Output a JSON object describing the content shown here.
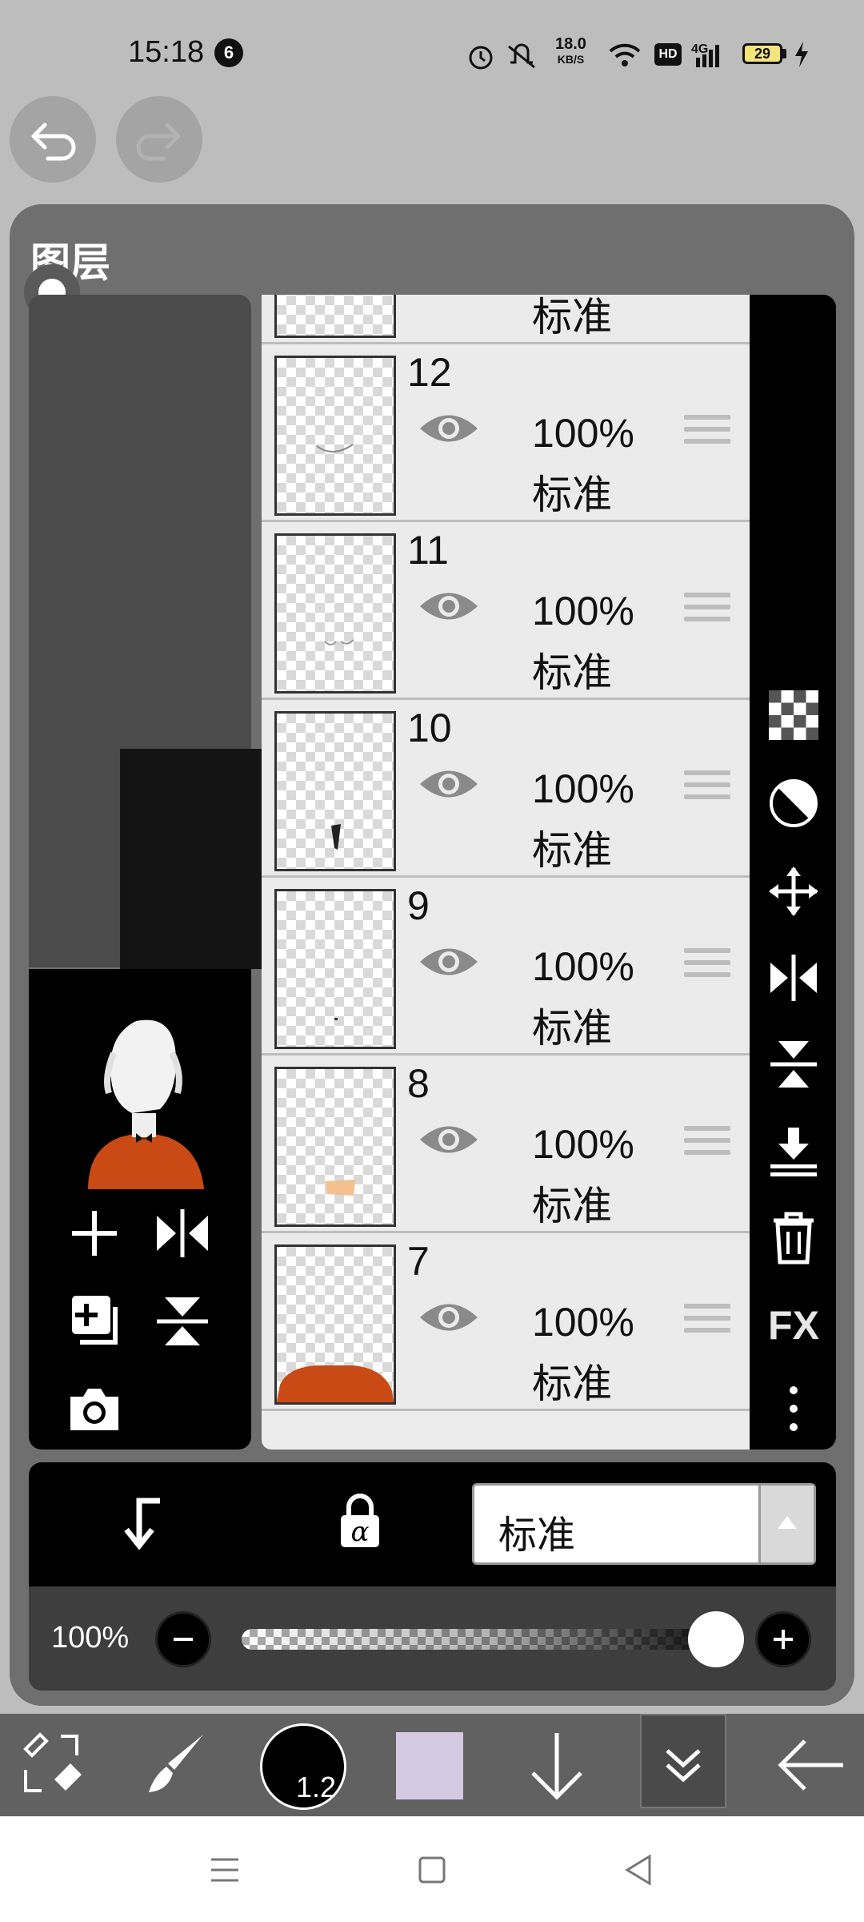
{
  "status_bar": {
    "time": "15:18",
    "notification_count": "6",
    "net_speed_value": "18.0",
    "net_speed_unit": "KB/S",
    "hd_label": "HD",
    "battery_level": "29"
  },
  "panel": {
    "title": "图层"
  },
  "layers": [
    {
      "number": "",
      "opacity": "",
      "blend": "标准"
    },
    {
      "number": "12",
      "opacity": "100%",
      "blend": "标准"
    },
    {
      "number": "11",
      "opacity": "100%",
      "blend": "标准"
    },
    {
      "number": "10",
      "opacity": "100%",
      "blend": "标准"
    },
    {
      "number": "9",
      "opacity": "100%",
      "blend": "标准"
    },
    {
      "number": "8",
      "opacity": "100%",
      "blend": "标准"
    },
    {
      "number": "7",
      "opacity": "100%",
      "blend": "标准"
    }
  ],
  "right_tools": {
    "fx_label": "FX"
  },
  "blend_bar": {
    "selected_mode": "标准"
  },
  "opacity_slider": {
    "value_label": "100%",
    "value": 1.0
  },
  "toolbar": {
    "brush_size": "1.2",
    "current_color": "#d5c9e3"
  },
  "icons": {
    "undo": "undo-icon",
    "redo": "redo-icon",
    "add_layer": "plus-icon",
    "flip_horizontal": "flip-horizontal-icon",
    "duplicate": "duplicate-layer-icon",
    "flip_vertical": "flip-vertical-icon",
    "camera": "camera-icon",
    "transparent": "checkerboard-icon",
    "half_circle": "invert-icon",
    "move": "move-icon",
    "merge_down": "merge-down-icon",
    "delete": "trash-icon",
    "more": "more-vertical-icon",
    "clipping": "clipping-arrow-icon",
    "alpha_lock": "alpha-lock-icon",
    "tool_switch": "tool-swap-icon",
    "brush": "brush-icon",
    "down": "arrow-down-icon",
    "collapse": "double-chevron-down-icon",
    "back": "arrow-left-icon"
  }
}
